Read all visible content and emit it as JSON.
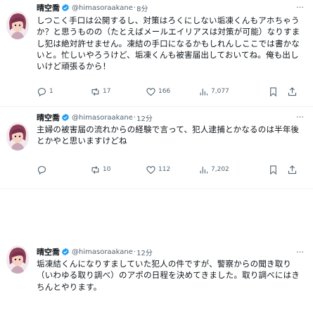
{
  "tweets": [
    {
      "name": "晴空喬",
      "handle": "@himasoraakane",
      "time": "8分",
      "text": "しつこく手口は公開するし、対策はろくにしない垢凍くんもアホちゃうか？と思うものの（たとえばメールエイリアスは対策が可能）なりすまし犯は絶対許せません。凍結の手口になるかもしれんしここでは書かないと。忙しいやろうけど、垢凍くんも被害届出しておいてね。俺も出しいけど頑張るから！",
      "reply": "1",
      "retweet": "17",
      "like": "166",
      "views": "7,077"
    },
    {
      "name": "晴空喬",
      "handle": "@himasoraakane",
      "time": "12分",
      "text": "主婦の被害届の流れからの経験で言って、犯人逮捕とかなるのは半年後とかやと思いますけどね",
      "reply": "",
      "retweet": "10",
      "like": "112",
      "views": "7,202"
    },
    {
      "name": "晴空喬",
      "handle": "@himasoraakane",
      "time": "12分",
      "text": "垢凍結くんになりすましていた犯人の件ですが、警察からの聞き取り（いわゆる取り調べ）のアポの日程を決めてきました。取り調べにはきちんとやります。",
      "reply": "",
      "retweet": "",
      "like": "",
      "views": ""
    }
  ],
  "more_label": "…",
  "dot": "·",
  "colors": {
    "verified": "#1d9bf0",
    "muted": "#536471",
    "text": "#0f1419"
  }
}
